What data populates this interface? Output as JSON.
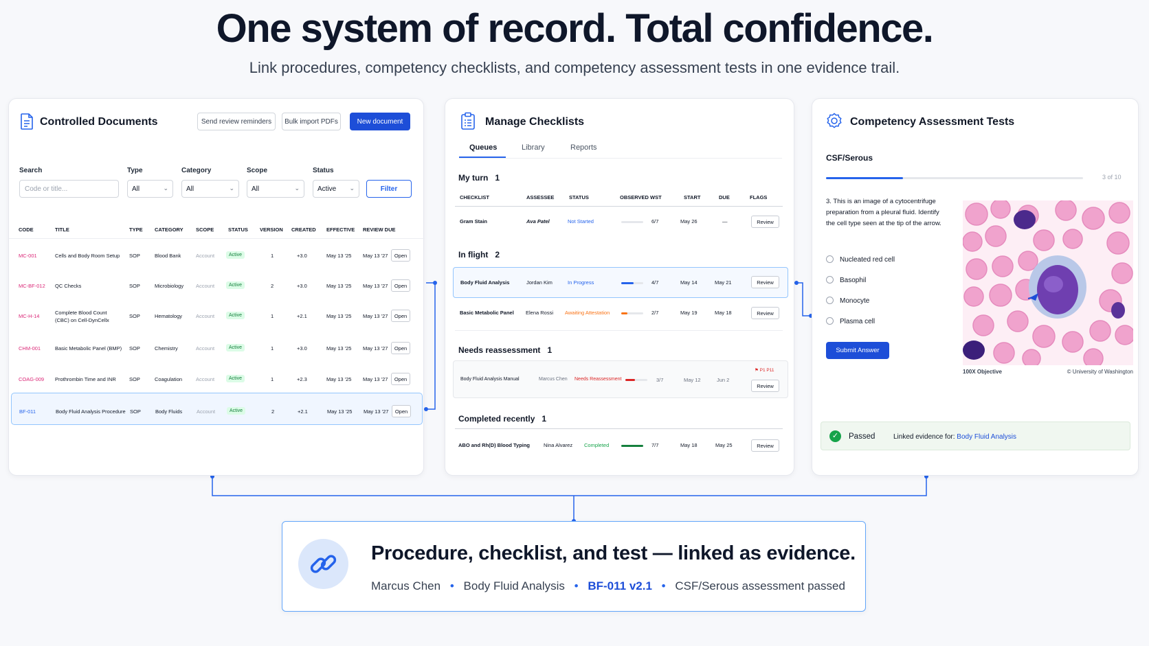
{
  "hero": {
    "title": "One system of record. Total confidence.",
    "subtitle": "Link procedures, competency checklists, and competency assessment tests in one evidence trail."
  },
  "documents": {
    "title": "Controlled Documents",
    "buttons": {
      "reminders": "Send review reminders",
      "bulk": "Bulk import PDFs",
      "new": "New document",
      "filter": "Filter"
    },
    "filters": {
      "search_label": "Search",
      "search_placeholder": "Code or title...",
      "type_label": "Type",
      "type_value": "All",
      "category_label": "Category",
      "category_value": "All",
      "scope_label": "Scope",
      "scope_value": "All",
      "status_label": "Status",
      "status_value": "Active"
    },
    "columns": [
      "CODE",
      "TITLE",
      "TYPE",
      "CATEGORY",
      "SCOPE",
      "STATUS",
      "VERSION",
      "CREATED",
      "EFFECTIVE",
      "REVIEW DUE"
    ],
    "open_label": "Open",
    "rows": [
      {
        "code": "MC-001",
        "title": "Cells and Body Room Setup",
        "title2": "",
        "type": "SOP",
        "category": "Blood Bank",
        "scope": "Account",
        "status": "Active",
        "version": "1",
        "created": "+3.0",
        "effective": "May 13 '25",
        "review_due": "May 13 '27"
      },
      {
        "code": "MC-BF-012",
        "title": "QC Checks",
        "title2": "",
        "type": "SOP",
        "category": "Microbiology",
        "scope": "Account",
        "status": "Active",
        "version": "2",
        "created": "+3.0",
        "effective": "May 13 '25",
        "review_due": "May 13 '27"
      },
      {
        "code": "MC-H-14",
        "title": "Complete Blood Count",
        "title2": "(CBC) on Cell-DynCellx",
        "type": "SOP",
        "category": "Hematology",
        "scope": "Account",
        "status": "Active",
        "version": "1",
        "created": "+2.1",
        "effective": "May 13 '25",
        "review_due": "May 13 '27"
      },
      {
        "code": "CHM-001",
        "title": "Basic Metabolic Panel (BMP)",
        "title2": "",
        "type": "SOP",
        "category": "Chemistry",
        "scope": "Account",
        "status": "Active",
        "version": "1",
        "created": "+3.0",
        "effective": "May 13 '25",
        "review_due": "May 13 '27"
      },
      {
        "code": "COAG-009",
        "title": "Prothrombin Time and INR",
        "title2": "",
        "type": "SOP",
        "category": "Coagulation",
        "scope": "Account",
        "status": "Active",
        "version": "1",
        "created": "+2.3",
        "effective": "May 13 '25",
        "review_due": "May 13 '27"
      },
      {
        "code": "BF-011",
        "title": "Body Fluid Analysis Procedure",
        "title2": "",
        "type": "SOP",
        "category": "Body Fluids",
        "scope": "Account",
        "status": "Active",
        "version": "2",
        "created": "+2.1",
        "effective": "May 13 '25",
        "review_due": "May 13 '27"
      }
    ]
  },
  "checklists": {
    "title": "Manage Checklists",
    "tabs": [
      "Queues",
      "Library",
      "Reports"
    ],
    "columns": [
      "CHECKLIST",
      "ASSESSEE",
      "STATUS",
      "OBSERVED WST",
      "START",
      "DUE",
      "FLAGS"
    ],
    "review_label": "Review",
    "sections": {
      "myturn": {
        "label": "My turn",
        "count": "1"
      },
      "inflight": {
        "label": "In flight",
        "count": "2"
      },
      "reassess": {
        "label": "Needs reassessment",
        "count": "1"
      },
      "completed": {
        "label": "Completed recently",
        "count": "1"
      }
    },
    "rows": {
      "gram": {
        "checklist": "Gram Stain",
        "assessee": "Ava Patel",
        "status": "Not Started",
        "progress": 0,
        "observed": "6/7",
        "start": "May 26",
        "due": "—"
      },
      "bfa": {
        "checklist": "Body Fluid Analysis",
        "assessee": "Jordan Kim",
        "status": "In Progress",
        "progress": 0.57,
        "observed": "4/7",
        "start": "May 14",
        "due": "May 21"
      },
      "bmp": {
        "checklist": "Basic Metabolic Panel",
        "assessee": "Elena Rossi",
        "status": "Awaiting Attestation",
        "progress": 0.29,
        "observed": "2/7",
        "start": "May 19",
        "due": "May 18"
      },
      "bfam": {
        "checklist": "Body Fluid Analysis Manual",
        "assessee": "Marcus Chen",
        "status": "Needs Reassessment",
        "progress": 0.43,
        "observed": "3/7",
        "start": "May 12",
        "due": "Jun 2",
        "flag": "P1 P11"
      },
      "abo": {
        "checklist": "ABO and Rh(D) Blood Typing",
        "assessee": "Nina Alvarez",
        "status": "Completed",
        "progress": 1,
        "observed": "7/7",
        "start": "May 18",
        "due": "May 25"
      }
    }
  },
  "assessment": {
    "title": "Competency Assessment Tests",
    "subtitle": "CSF/Serous",
    "progress_text": "3 of 10",
    "progress": 0.3,
    "question": "3. This is an image of a cytocentrifuge preparation from a pleural fluid. Identify the cell type seen at the tip of the arrow.",
    "options": [
      "Nucleated red cell",
      "Basophil",
      "Monocyte",
      "Plasma cell"
    ],
    "submit": "Submit Answer",
    "image_caption_left": "100X Objective",
    "image_caption_right": "© University of Washington",
    "result": "Passed",
    "linked_text": "Linked evidence for:",
    "linked_link": "Body Fluid Analysis"
  },
  "evidence": {
    "title": "Procedure, checklist, and test — linked as evidence.",
    "person": "Marcus Chen",
    "checklist": "Body Fluid Analysis",
    "doc": "BF-011 v2.1",
    "result": "CSF/Serous assessment passed",
    "sep": "•"
  },
  "colors": {
    "accent": "#1d4ed8",
    "code": "#db2777",
    "active_bg": "#dcfce7",
    "passed": "#16a34a",
    "orange": "#f97316",
    "red": "#dc2626"
  }
}
